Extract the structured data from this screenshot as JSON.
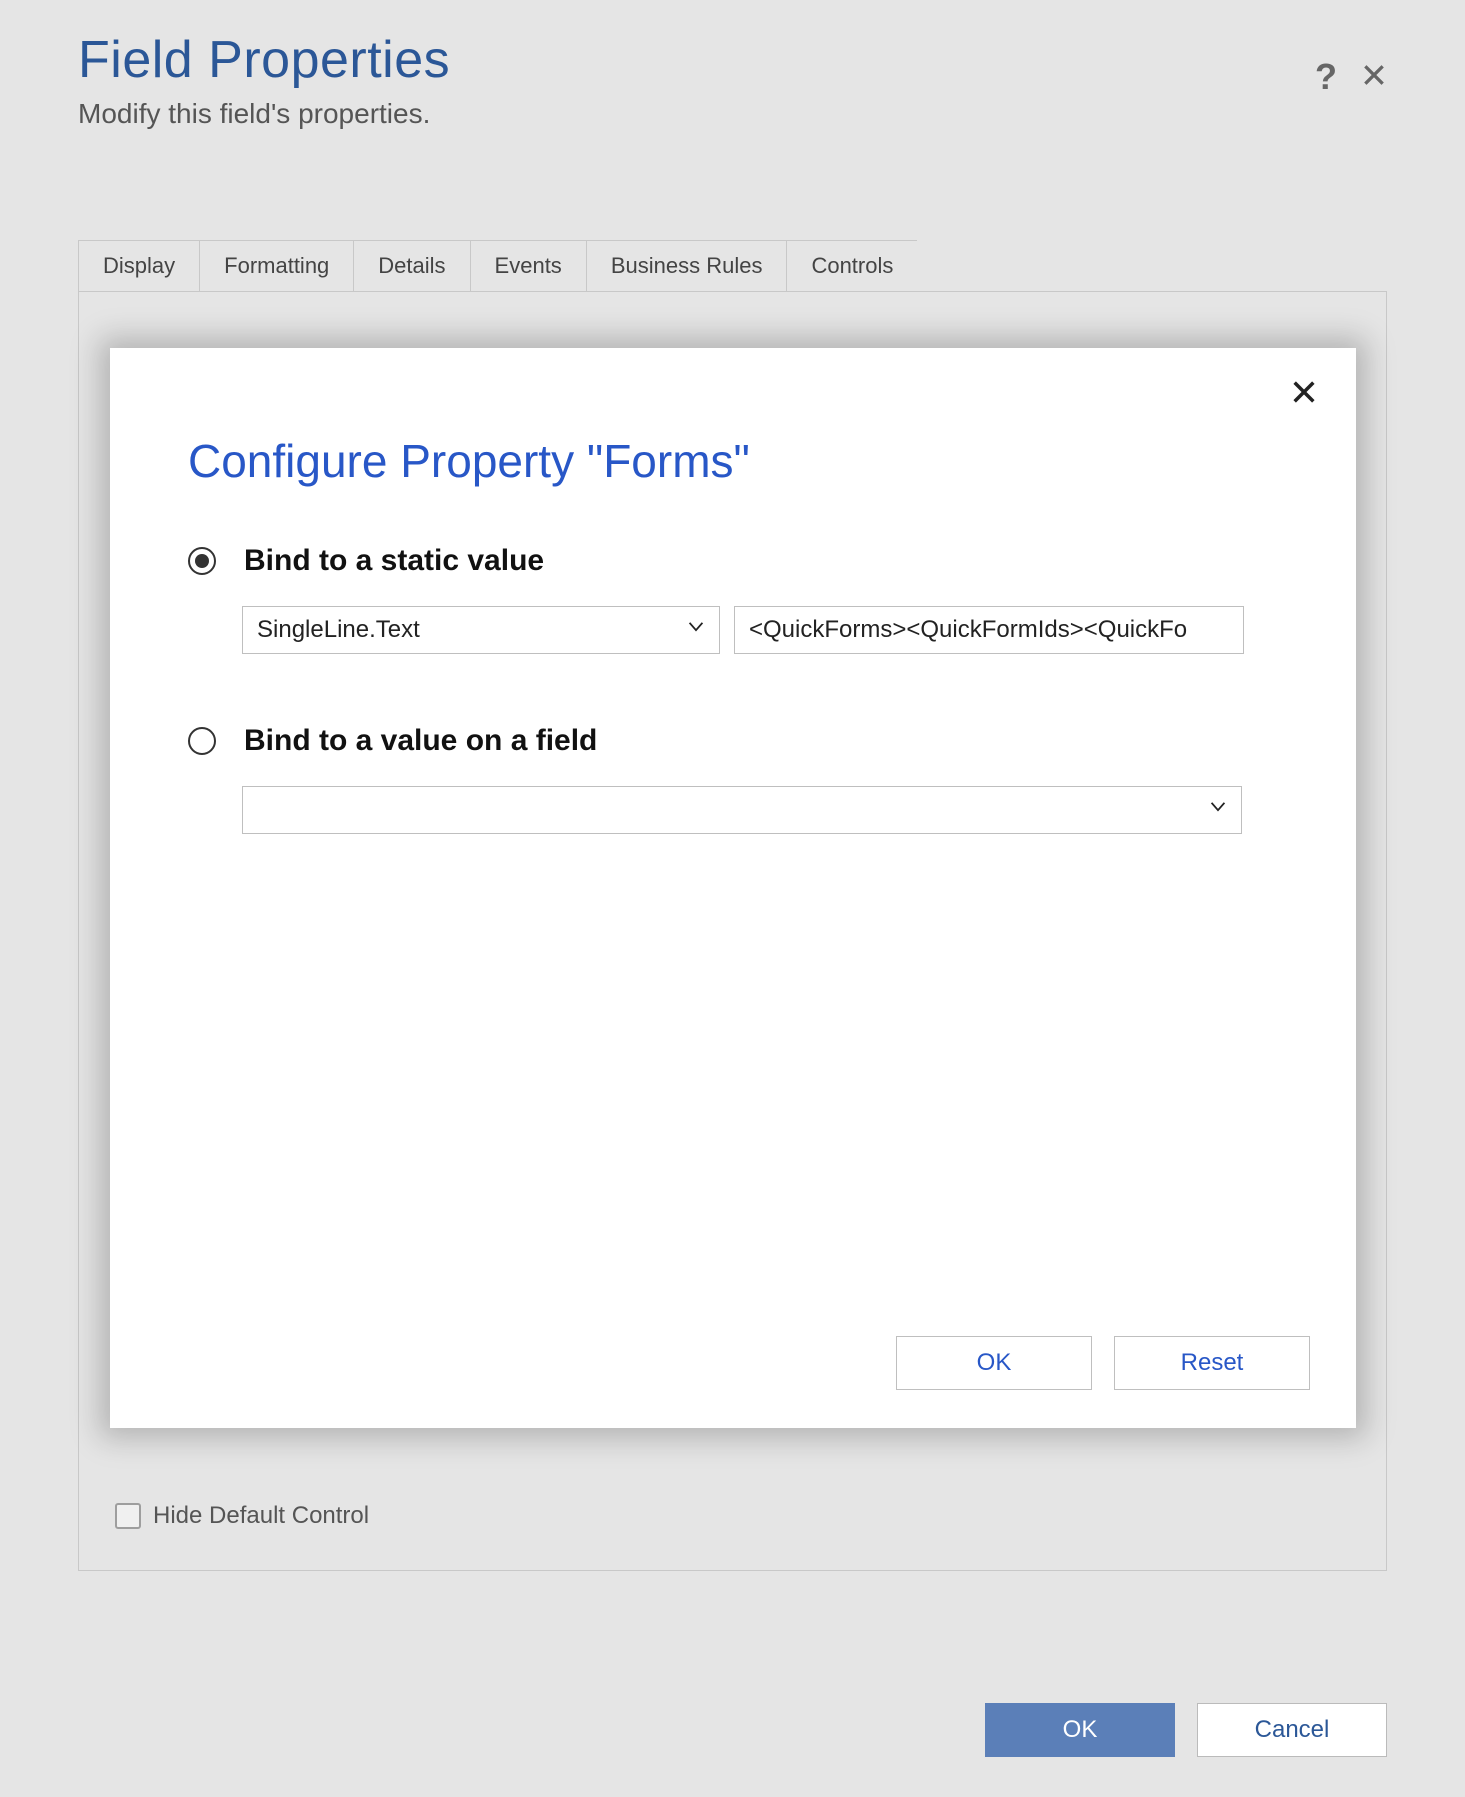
{
  "page": {
    "title": "Field Properties",
    "subtitle": "Modify this field's properties."
  },
  "tabs": [
    {
      "label": "Display"
    },
    {
      "label": "Formatting"
    },
    {
      "label": "Details"
    },
    {
      "label": "Events"
    },
    {
      "label": "Business Rules"
    },
    {
      "label": "Controls"
    }
  ],
  "panel": {
    "hideDefaultLabel": "Hide Default Control",
    "hideDefaultChecked": false
  },
  "footer": {
    "ok": "OK",
    "cancel": "Cancel"
  },
  "modal": {
    "title": "Configure Property \"Forms\"",
    "optionStatic": {
      "label": "Bind to a static value",
      "selected": true,
      "typeValue": "SingleLine.Text",
      "textValue": "<QuickForms><QuickFormIds><QuickFo"
    },
    "optionField": {
      "label": "Bind to a value on a field",
      "selected": false,
      "fieldValue": ""
    },
    "buttons": {
      "ok": "OK",
      "reset": "Reset"
    }
  }
}
